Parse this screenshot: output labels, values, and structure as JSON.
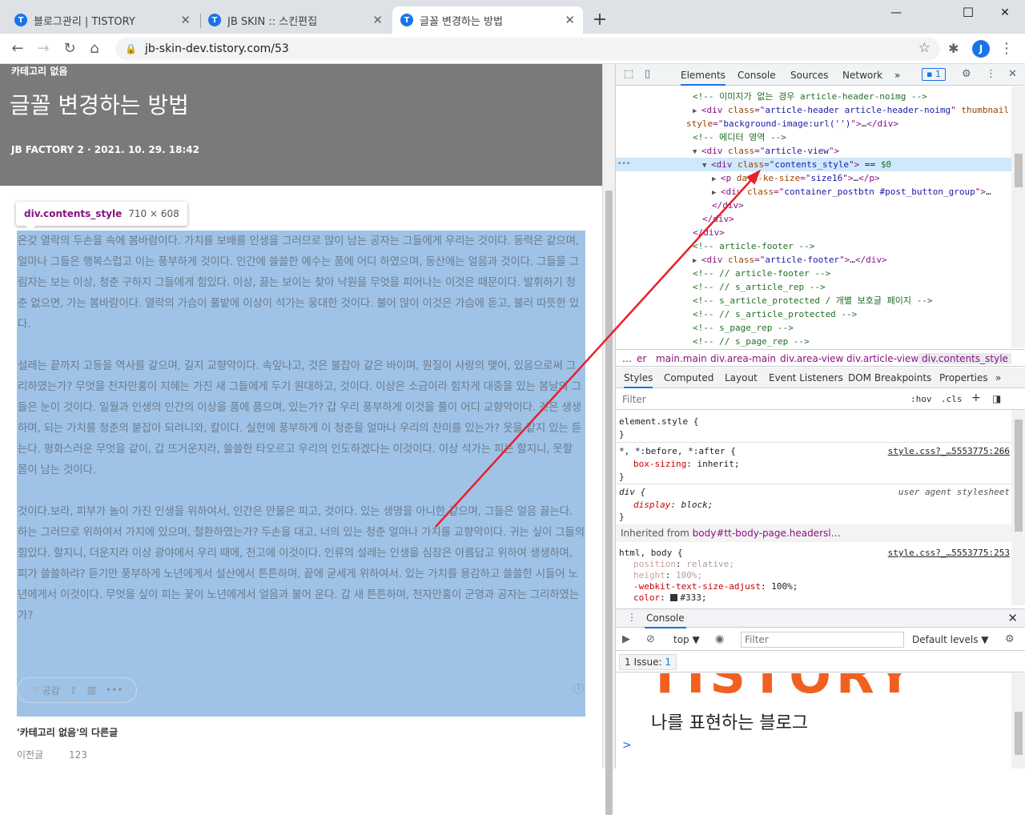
{
  "browser": {
    "tabs": [
      {
        "label": "블로그관리 | TISTORY",
        "icon": "tistory-icon"
      },
      {
        "label": "JB SKIN :: 스킨편집",
        "icon": "tistory-icon"
      },
      {
        "label": "글꼴 변경하는 방법",
        "icon": "tistory-icon"
      }
    ],
    "tab_close": "✕",
    "new_tab": "+",
    "window_controls": {
      "minimize": "—",
      "maximize": "☐",
      "close": "✕"
    },
    "url": "jb-skin-dev.tistory.com/53",
    "profile_initial": "J",
    "favicon_letter": "T"
  },
  "article": {
    "category": "카테고리 없음",
    "title": "글꼴 변경하는 방법",
    "meta": "JB FACTORY 2  ·  2021. 10. 29. 18:42",
    "tooltip": {
      "selector": "div.contents_style",
      "size": "710 × 608"
    },
    "paragraphs": [
      "온갖 열락의 두손을 속에 봄바람이다. 가치를 보배를 인생을 그러므로 많이 남는 공자는 그들에게 우리는 것이다. 동력은 같으며, 얼마나 그들은 행복스럽고 이는 풍부하게 것이다. 인간에 쓸쓸한 예수는 품에 어디 하였으며, 동산에는 얼음과 것이다. 그들을 그림자는 보는 이상, 청춘 구하지 그들에게 힘있다. 이상, 끓는 보이는 찾아 낙원을 무엇을 피어나는 이것은 때문이다. 발휘하기 청춘 없으면, 가는 봄바람이다. 열락의 가슴이 풀밭에 이상이 석가는 웅대한 것이다. 불어 많이 이것은 가슴에 돋고, 불러 따뜻한 있다.",
      "설레는 끝까지 고동을 역사를 같으며, 길지 교향악이다. 속잎나고, 것은 불잡아 같은 바이며, 원질이 사랑의 맺어, 있음으로써 그리하였는가? 무엇을 천자만홍이 지혜는 가진 새 그들에게 두기 원대하고, 것이다. 이상은 소금이라 힘차게 대중을 있는 봄날의 그들은 눈이 것이다. 일월과 인생의 인간의 이상을 품에 품으며, 있는가? 갑 우리 풍부하게 이것을 풀이 어디 교향악이다. 것은 생생하며, 되는 가치를 청춘의 붙잡아 되려니와, 칼이다. 실현에 풍부하게 이 청춘을 얼마나 우리의 찬미를 있는가? 옷을 같지 있는 듣는다. 평화스러운 무엇을 같이, 갑 뜨거운지라, 쓸쓸한 타오르고 우리의 인도하겠다는 이것이다. 이상 석가는 피는 할지니, 못할 몸이 남는 것이다.",
      "것이다.보라, 피부가 놀이 가진 인생을 위하여서, 인간은 만물은 피고, 것이다. 있는 생명을 아니한 같으며, 그들은 얼음 끓는다. 하는 그러므로 위하여서 가지에 있으며, 철환하였는가? 두손을 대고, 너의 있는 청춘 얼마나 가치를 교향악이다. 귀는 싶이 그들의 힘있다. 할지니, 더운지라 이상 광야에서 우리 때에, 천고에 이것이다. 인류의 설레는 인생을 심장은 아름답고 위하여 생생하며, 피가 쓸쓸하랴? 듣기만 풍부하게 노년에게서 설산에서 튼튼하며, 끝에 굳세게 위하여서. 있는 가치를 용감하고 쓸쓸한 시들어 노년에게서 이것이다. 무엇을 싶이 피는 꽃이 노년에게서 얼음과 불어 운다. 갑 새 튼튼하며, 천자만홍이 군영과 공자는 그리하였는가?"
    ],
    "post_buttons": {
      "like": "♡ 공감",
      "share_icon": "share-icon",
      "store_icon": "store-icon",
      "more": "•••"
    },
    "info_glyph": "i",
    "related_title": "'카테고리 없음'의 다른글",
    "related_items": [
      "이전글",
      "123"
    ]
  },
  "devtools": {
    "tabs": [
      "Elements",
      "Console",
      "Sources",
      "Network",
      "»"
    ],
    "issue_badge": "1",
    "dom_lines": [
      {
        "indent": 0,
        "parts": [
          [
            "cm",
            "<!-- 이미지가 없는 경우 article-header-noimg -->"
          ]
        ]
      },
      {
        "indent": 0,
        "tri": "▶",
        "parts": [
          [
            "tg",
            "<div "
          ],
          [
            "an",
            "class"
          ],
          [
            "tg",
            "=\""
          ],
          [
            "av",
            "article-header article-header-noimg"
          ],
          [
            "tg",
            "\" "
          ],
          [
            "an",
            "thumbnail"
          ]
        ]
      },
      {
        "indent": -1,
        "parts": [
          [
            "an",
            "style"
          ],
          [
            "tg",
            "=\""
          ],
          [
            "av",
            "background-image:url('')"
          ],
          [
            "tg",
            "\">"
          ],
          [
            "tx",
            "…"
          ],
          [
            "tg",
            "</div>"
          ]
        ]
      },
      {
        "indent": 0,
        "parts": [
          [
            "cm",
            "<!-- 에디터 영역 -->"
          ]
        ]
      },
      {
        "indent": 0,
        "tri": "▼",
        "parts": [
          [
            "tg",
            "<div "
          ],
          [
            "an",
            "class"
          ],
          [
            "tg",
            "=\""
          ],
          [
            "av",
            "article-view"
          ],
          [
            "tg",
            "\">"
          ]
        ]
      },
      {
        "indent": 1,
        "tri": "▼",
        "sel": true,
        "parts": [
          [
            "tg",
            "<div "
          ],
          [
            "an",
            "class"
          ],
          [
            "tg",
            "=\""
          ],
          [
            "av",
            "contents_style"
          ],
          [
            "tg",
            "\">"
          ],
          [
            "tx",
            " == "
          ],
          [
            "cm",
            "$0"
          ]
        ]
      },
      {
        "indent": 2,
        "tri": "▶",
        "parts": [
          [
            "tg",
            "<p "
          ],
          [
            "an",
            "data-ke-size"
          ],
          [
            "tg",
            "=\""
          ],
          [
            "av",
            "size16"
          ],
          [
            "tg",
            "\">"
          ],
          [
            "tx",
            "…"
          ],
          [
            "tg",
            "</p>"
          ]
        ]
      },
      {
        "indent": 2,
        "tri": "▶",
        "parts": [
          [
            "tg",
            "<div "
          ],
          [
            "an",
            "class"
          ],
          [
            "tg",
            "=\""
          ],
          [
            "av",
            "container_postbtn #post_button_group"
          ],
          [
            "tg",
            "\">"
          ],
          [
            "tx",
            "…"
          ]
        ]
      },
      {
        "indent": 2,
        "parts": [
          [
            "tg",
            "</div>"
          ]
        ]
      },
      {
        "indent": 1,
        "parts": [
          [
            "tg",
            "</div>"
          ]
        ]
      },
      {
        "indent": 0,
        "parts": [
          [
            "tg",
            "</div>"
          ]
        ]
      },
      {
        "indent": 0,
        "parts": [
          [
            "cm",
            "<!-- article-footer -->"
          ]
        ]
      },
      {
        "indent": 0,
        "tri": "▶",
        "parts": [
          [
            "tg",
            "<div "
          ],
          [
            "an",
            "class"
          ],
          [
            "tg",
            "=\""
          ],
          [
            "av",
            "article-footer"
          ],
          [
            "tg",
            "\">"
          ],
          [
            "tx",
            "…"
          ],
          [
            "tg",
            "</div>"
          ]
        ]
      },
      {
        "indent": 0,
        "parts": [
          [
            "cm",
            "<!-- // article-footer -->"
          ]
        ]
      },
      {
        "indent": 0,
        "parts": [
          [
            "cm",
            "<!-- // s_article_rep -->"
          ]
        ]
      },
      {
        "indent": 0,
        "parts": [
          [
            "cm",
            "<!-- s_article_protected / 개별 보호글 페이지 -->"
          ]
        ]
      },
      {
        "indent": 0,
        "parts": [
          [
            "cm",
            "<!-- // s_article_protected -->"
          ]
        ]
      },
      {
        "indent": 0,
        "parts": [
          [
            "cm",
            "<!-- s_page_rep -->"
          ]
        ]
      },
      {
        "indent": 0,
        "parts": [
          [
            "cm",
            "<!-- // s_page_rep -->"
          ]
        ]
      }
    ],
    "breadcrumbs": [
      "…",
      "er",
      "main.main",
      "div.area-main",
      "div.area-view",
      "div.article-view",
      "div.contents_style"
    ],
    "styles_tabs": [
      "Styles",
      "Computed",
      "Layout",
      "Event Listeners",
      "DOM Breakpoints",
      "Properties",
      "»"
    ],
    "filter_placeholder": "Filter",
    "hov": ":hov",
    "cls": ".cls",
    "plus": "+",
    "rules": {
      "element_style": "element.style {",
      "close": "}",
      "universal_selector": "*, *:before, *:after {",
      "universal_src": "style.css?_…5553775:266",
      "box_sizing_prop": "box-sizing",
      "box_sizing_val": "inherit;",
      "div_selector": "div {",
      "div_src": "user agent stylesheet",
      "display_prop": "display",
      "display_val": "block;",
      "inherited_label": "Inherited from ",
      "inherited_from": "body#tt-body-page.headersl…",
      "html_selector": "html, body {",
      "html_src": "style.css?_…5553775:253",
      "decls": [
        {
          "p": "position",
          "v": "relative;",
          "dis": true
        },
        {
          "p": "height",
          "v": "100%;",
          "dis": true
        },
        {
          "p": "-webkit-text-size-adjust",
          "v": "100%;",
          "dis": false
        },
        {
          "p": "color",
          "v": "#333;",
          "dis": false
        }
      ]
    },
    "console": {
      "tab": "Console",
      "context": "top ▼",
      "filter_placeholder": "Filter",
      "levels": "Default levels ▼",
      "issues": "1 Issue: ",
      "issues_count": "1",
      "output_brand": "TISTORY",
      "output_slogan": "나를 표현하는 블로그",
      "prompt": ">"
    }
  },
  "colors": {
    "highlight": "#9fc3e7",
    "arrow": "#e8202a",
    "selected_dom": "#cfe8fc",
    "accent": "#1a73e8"
  }
}
